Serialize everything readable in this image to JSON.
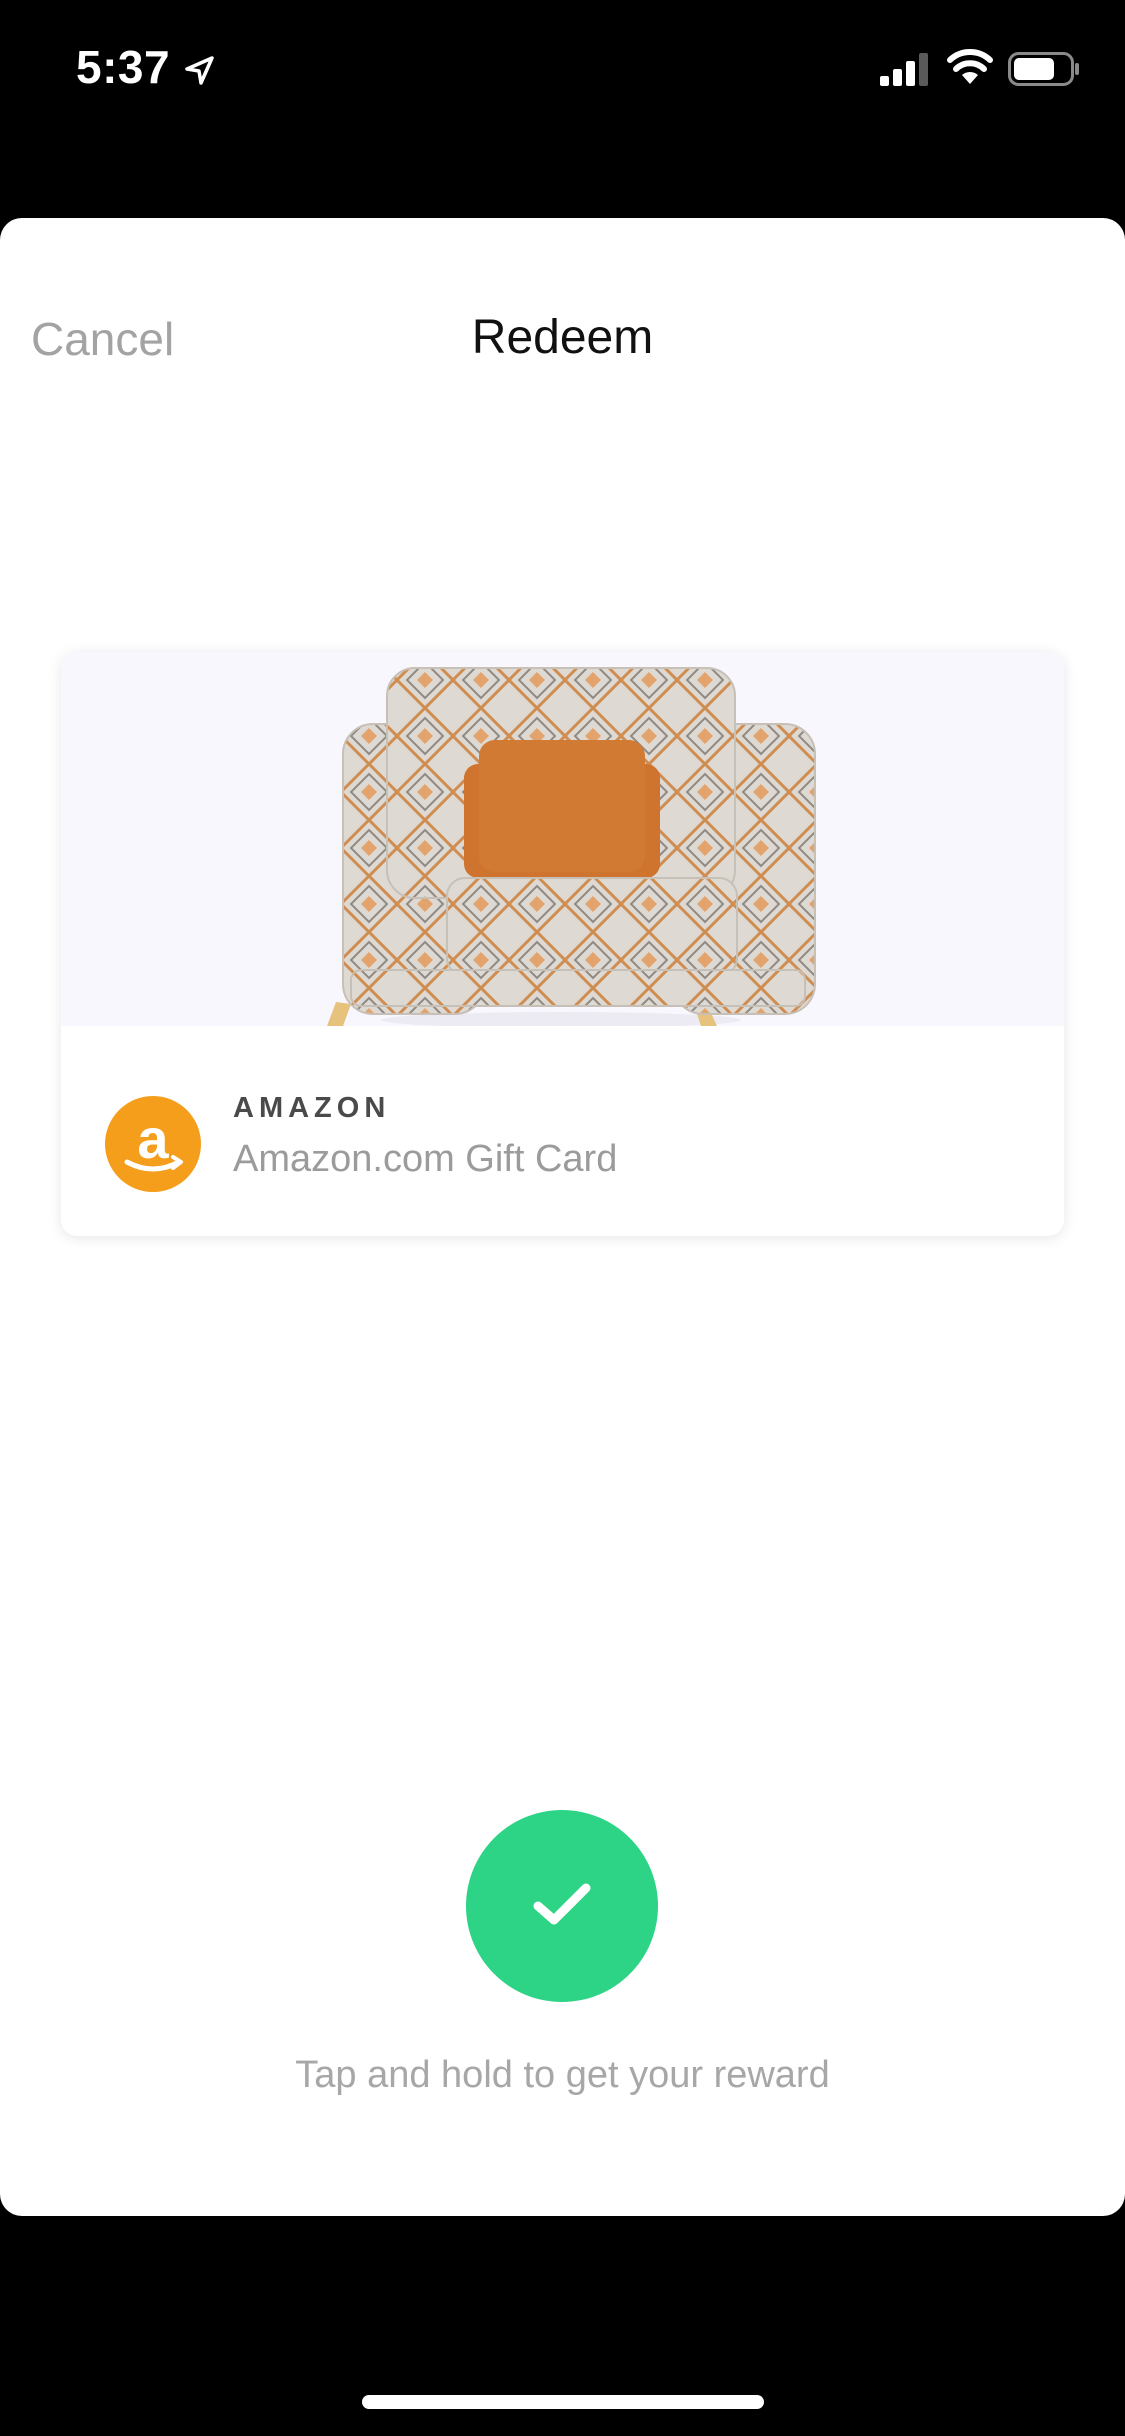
{
  "status_bar": {
    "time": "5:37",
    "icons": [
      "location-arrow-icon",
      "cellular-signal-icon",
      "wifi-icon",
      "battery-icon"
    ]
  },
  "nav": {
    "cancel_label": "Cancel",
    "title": "Redeem"
  },
  "reward": {
    "image": "armchair-image",
    "brand_logo": "amazon-logo",
    "brand": "AMAZON",
    "product": "Amazon.com Gift Card"
  },
  "action": {
    "button_icon": "checkmark-icon",
    "hint": "Tap and hold to get your reward"
  },
  "colors": {
    "accent_green": "#2dd486",
    "amazon_orange": "#f59e1c",
    "muted_text": "#a3a3a3"
  }
}
